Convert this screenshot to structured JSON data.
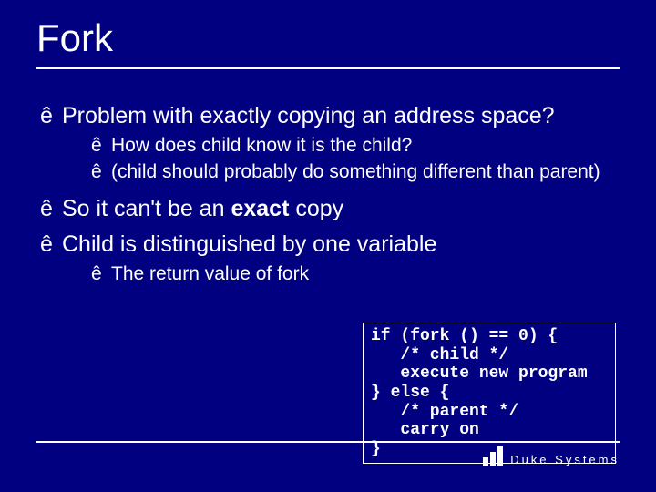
{
  "title": "Fork",
  "bullets": {
    "b1": "Problem with exactly copying an address space?",
    "b1_1": "How does child know it is the child?",
    "b1_2": "(child should probably do something different than parent)",
    "b2_pre": "So it can't be an ",
    "b2_bold": "exact",
    "b2_post": " copy",
    "b3": "Child is distinguished by one variable",
    "b3_1": "The return value of fork"
  },
  "code": "if (fork () == 0) {\n   /* child */\n   execute new program\n} else {\n   /* parent */\n   carry on\n}",
  "footer": {
    "brand": "Duke Systems"
  }
}
